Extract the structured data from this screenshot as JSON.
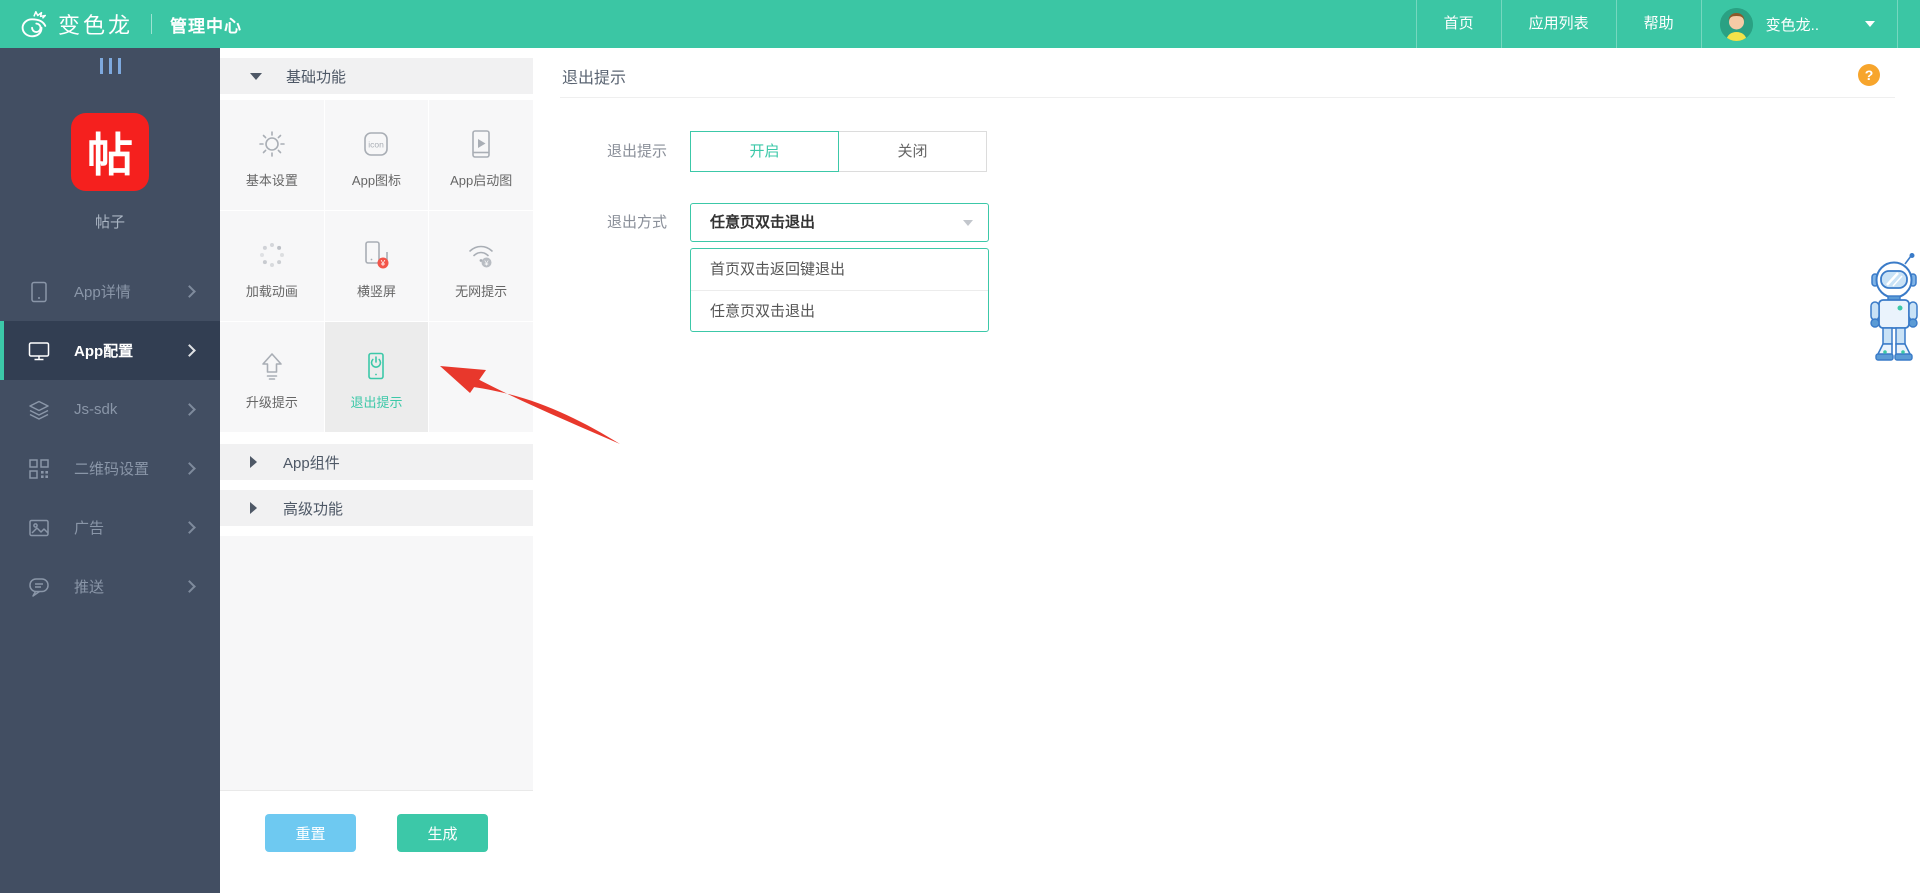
{
  "topbar": {
    "logo_text": "变色龙",
    "title": "管理中心",
    "nav": [
      {
        "label": "首页"
      },
      {
        "label": "应用列表"
      },
      {
        "label": "帮助"
      }
    ],
    "user": {
      "name": "变色龙.."
    }
  },
  "sidebar": {
    "app": {
      "icon_char": "帖",
      "name": "帖子"
    },
    "items": [
      {
        "label": "App详情",
        "icon": "tablet-icon",
        "active": false
      },
      {
        "label": "App配置",
        "icon": "monitor-icon",
        "active": true
      },
      {
        "label": "Js-sdk",
        "icon": "layers-icon",
        "active": false
      },
      {
        "label": "二维码设置",
        "icon": "qrcode-icon",
        "active": false
      },
      {
        "label": "广告",
        "icon": "image-icon",
        "active": false
      },
      {
        "label": "推送",
        "icon": "chat-icon",
        "active": false
      }
    ]
  },
  "panel": {
    "sections": [
      {
        "label": "基础功能",
        "expanded": true
      },
      {
        "label": "App组件",
        "expanded": false
      },
      {
        "label": "高级功能",
        "expanded": false
      }
    ],
    "grid": [
      {
        "label": "基本设置",
        "icon": "gear-icon",
        "active": false
      },
      {
        "label": "App图标",
        "icon": "app-icon-placeholder",
        "icon_text": "icon",
        "active": false
      },
      {
        "label": "App启动图",
        "icon": "splash-screen-icon",
        "active": false
      },
      {
        "label": "加载动画",
        "icon": "loading-spinner-icon",
        "active": false
      },
      {
        "label": "横竖屏",
        "icon": "orientation-icon",
        "badge": "paid-badge",
        "active": false
      },
      {
        "label": "无网提示",
        "icon": "no-network-icon",
        "badge": "paid-badge-gray",
        "active": false
      },
      {
        "label": "升级提示",
        "icon": "upgrade-arrow-icon",
        "active": false
      },
      {
        "label": "退出提示",
        "icon": "exit-power-icon",
        "active": true
      }
    ],
    "reset_label": "重置",
    "generate_label": "生成"
  },
  "main": {
    "title": "退出提示",
    "help_label": "?",
    "rows": [
      {
        "label": "退出提示",
        "type": "toggle",
        "options": [
          "开启",
          "关闭"
        ],
        "selected": "开启"
      },
      {
        "label": "退出方式",
        "type": "select",
        "value": "任意页双击退出",
        "options": [
          "首页双击返回键退出",
          "任意页双击退出"
        ]
      }
    ]
  },
  "colors": {
    "accent_teal": "#3CC8A8",
    "topbar_teal": "#3BC6A4",
    "sidebar_navy": "#424E62",
    "app_badge_red": "#F5201E",
    "reset_blue": "#6EC9F1",
    "arrow_red": "#E8382C",
    "help_orange": "#F7A52C"
  }
}
